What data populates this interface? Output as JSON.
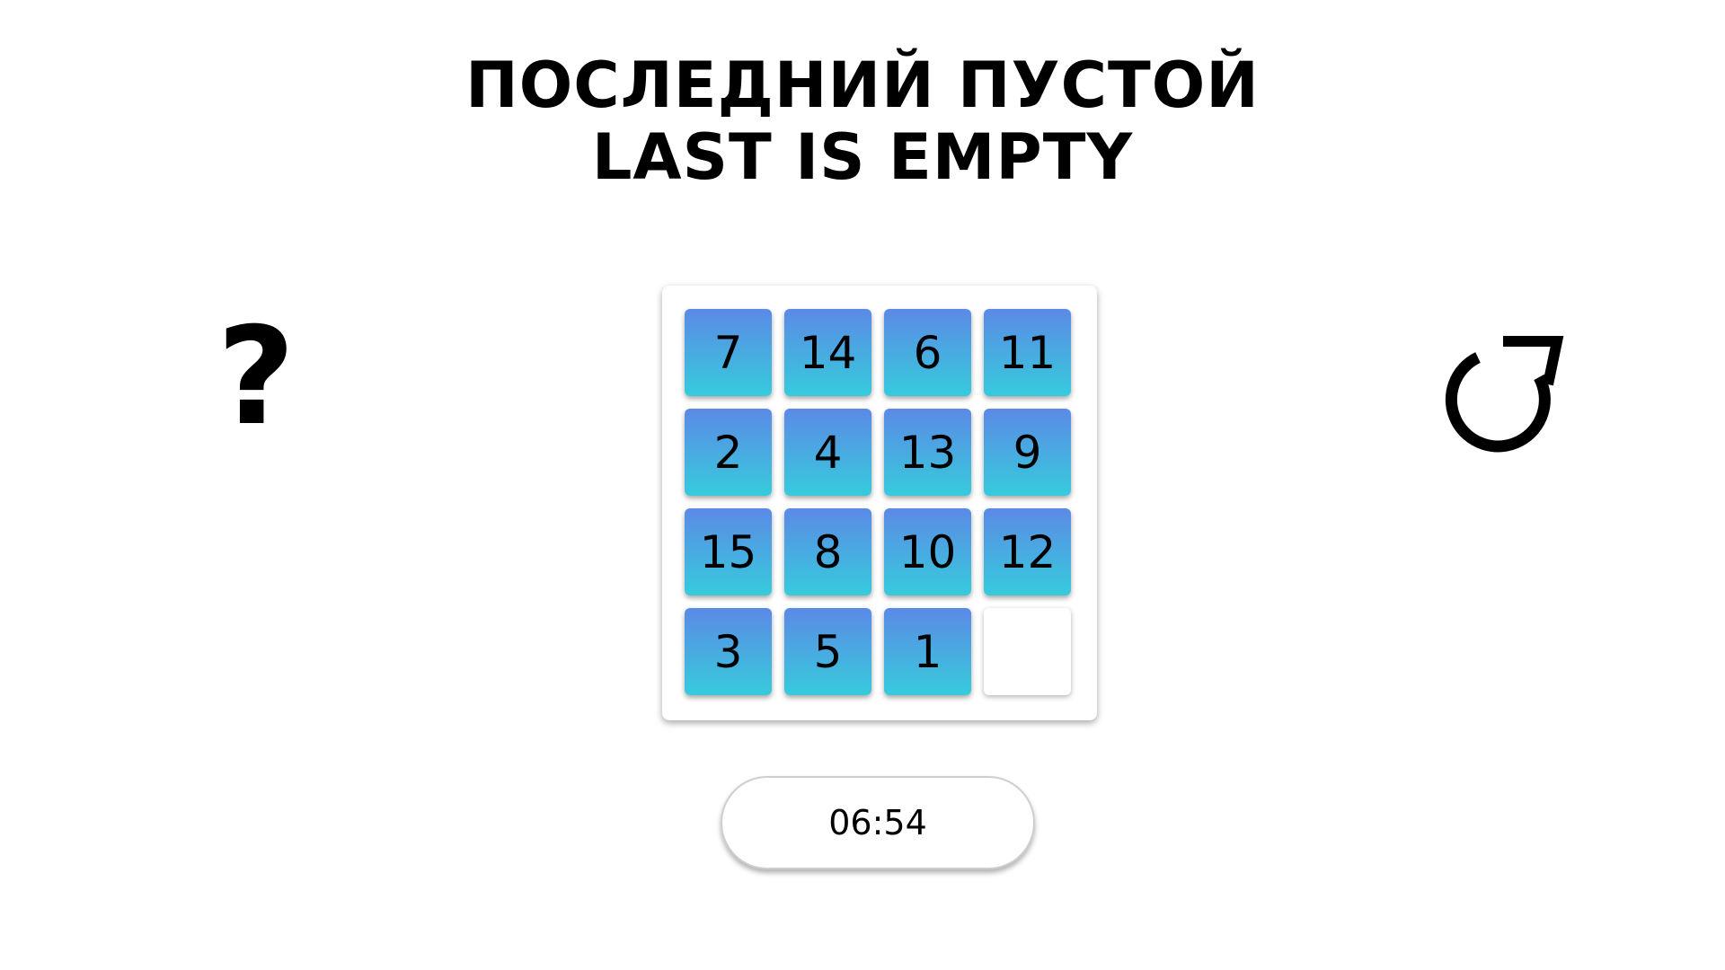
{
  "title": {
    "line1": "ПОСЛЕДНИЙ ПУСТОЙ",
    "line2": "LAST IS EMPTY"
  },
  "help_button": {
    "label": "?",
    "icon": "question-mark-icon"
  },
  "restart_button": {
    "icon": "restart-arrow-icon"
  },
  "board": {
    "rows": [
      [
        "7",
        "14",
        "6",
        "11"
      ],
      [
        "2",
        "4",
        "13",
        "9"
      ],
      [
        "15",
        "8",
        "10",
        "12"
      ],
      [
        "3",
        "5",
        "1",
        ""
      ]
    ]
  },
  "timer": {
    "value": "06:54"
  },
  "colors": {
    "tile_top": "#5b8ae6",
    "tile_bottom": "#36cbdc",
    "background": "#ffffff",
    "text": "#000000"
  }
}
